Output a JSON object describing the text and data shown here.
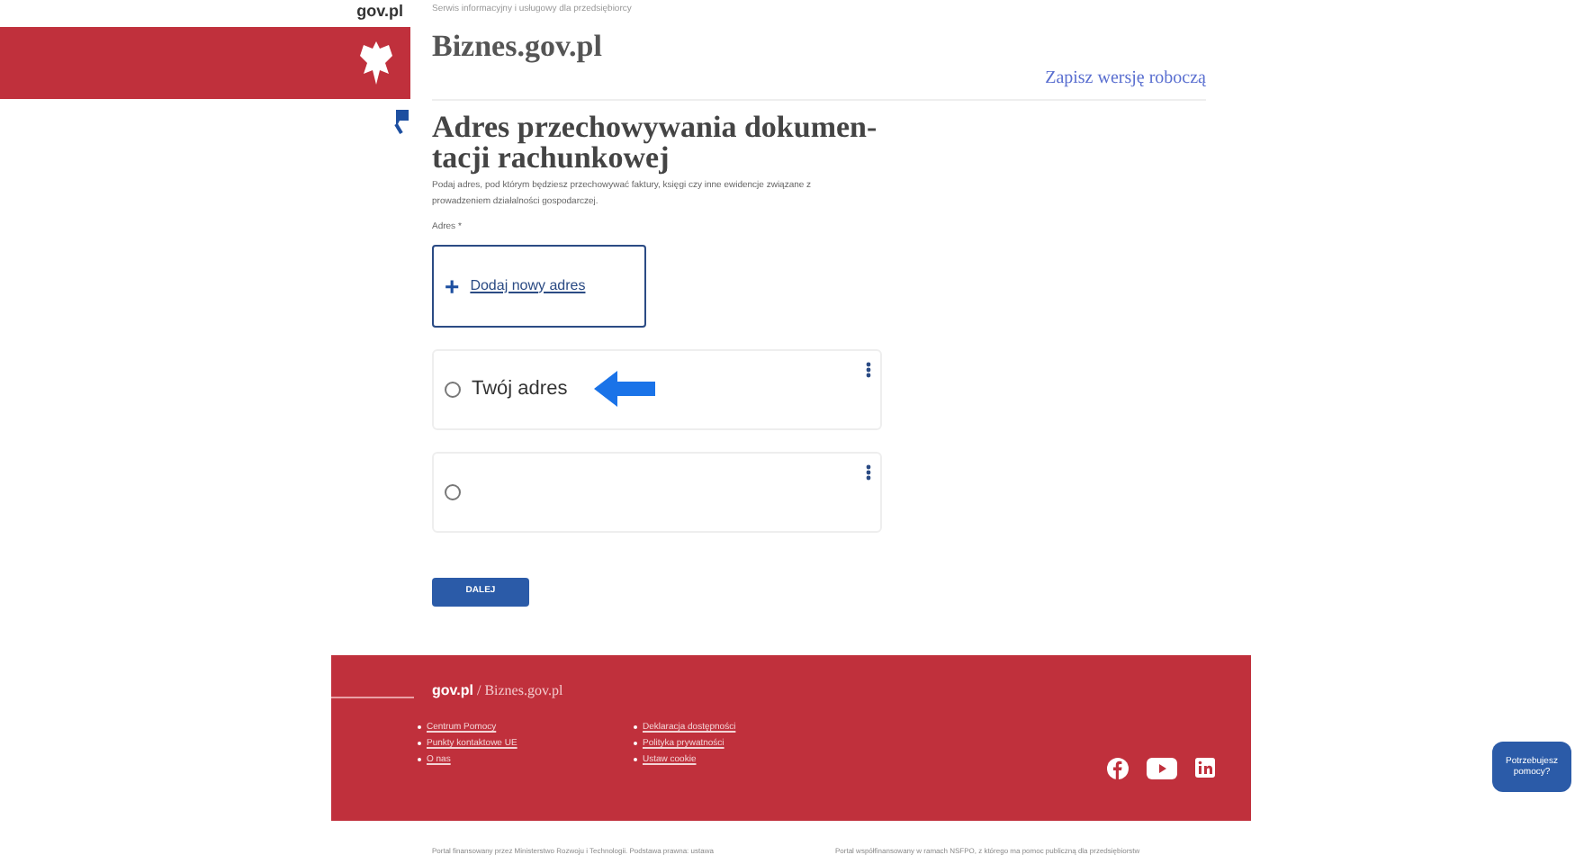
{
  "header": {
    "gov_logo": "gov.pl",
    "tagline": "Serwis informacyjny i usługowy dla przedsiębiorcy",
    "site_title": "Biznes.gov.pl",
    "save_draft": "Zapisz wersję roboczą"
  },
  "page": {
    "heading": "Adres przechowywania dokumen-tacji rachunkowej",
    "description": "Podaj adres, pod którym będziesz przechowywać faktury, księgi czy inne ewidencje związane z prowadzeniem działalności gospodarczej.",
    "field_label": "Adres *",
    "add_address": {
      "icon": "+",
      "label": "Dodaj nowy adres"
    },
    "options": [
      {
        "label": "Twój adres",
        "selected": false,
        "pointer": true
      },
      {
        "selected": false,
        "pointer": false
      }
    ],
    "next_button": "DALEJ"
  },
  "footer": {
    "gov": "gov.pl",
    "site": "/ Biznes.gov.pl",
    "links_left": [
      "Centrum Pomocy",
      "Punkty kontaktowe UE",
      "O nas"
    ],
    "links_right": [
      "Deklaracja dostępności",
      "Polityka prywatności",
      "Ustaw cookie"
    ]
  },
  "legal": [
    "Portal finansowany przez Ministerstwo Rozwoju i Technologii. Podstawa prawna: ustawa",
    "Portal współfinansowany w ramach NSFPO, z którego ma pomoc publiczną dla przedsiębiorstw"
  ],
  "chat": "Potrzebujesz pomocy?"
}
